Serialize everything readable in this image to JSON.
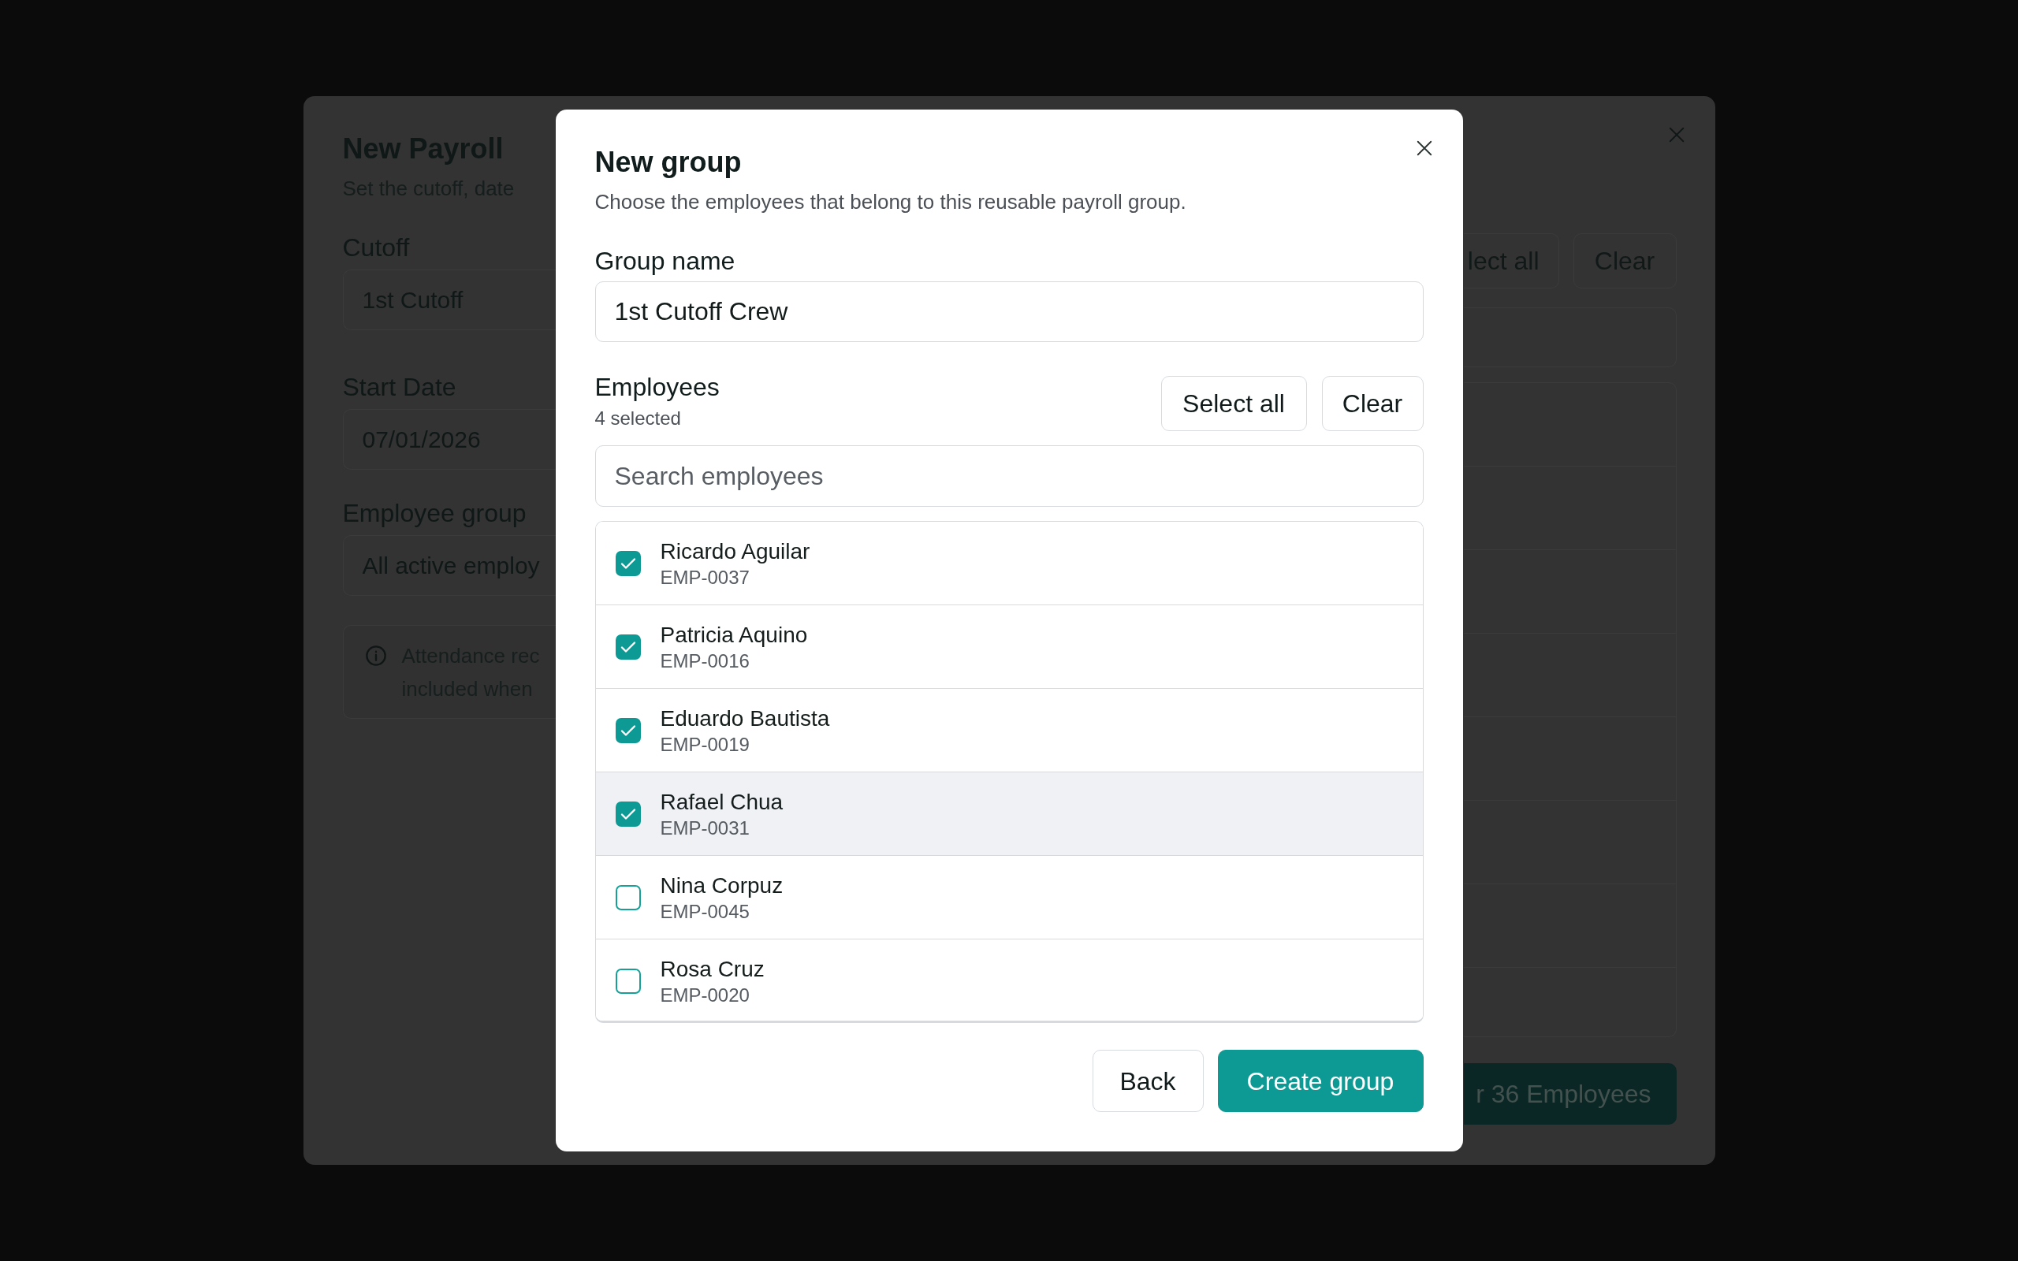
{
  "payroll_dialog": {
    "title": "New Payroll",
    "description": "Set the cutoff, date",
    "fields": [
      {
        "label": "Cutoff",
        "value": "1st Cutoff"
      },
      {
        "label": "Start Date",
        "value": "07/01/2026"
      },
      {
        "label": "Employee group",
        "value": "All active employ"
      }
    ],
    "notice": {
      "lines": [
        "Attendance rec",
        "included when"
      ]
    },
    "employee_buttons": [
      "lect all",
      "Clear"
    ],
    "submit_button": "r 36 Employees"
  },
  "group_dialog": {
    "title": "New group",
    "description": "Choose the employees that belong to this reusable payroll group.",
    "group_name": {
      "label": "Group name",
      "value": "1st Cutoff Crew"
    },
    "employees": {
      "label": "Employees",
      "count": "4 selected",
      "buttons": [
        "Select all",
        "Clear"
      ],
      "search": {
        "placeholder": "Search employees"
      },
      "rows": [
        {
          "name": "Ricardo Aguilar",
          "id": "EMP-0037",
          "checked": true,
          "hovered": false
        },
        {
          "name": "Patricia Aquino",
          "id": "EMP-0016",
          "checked": true,
          "hovered": false
        },
        {
          "name": "Eduardo Bautista",
          "id": "EMP-0019",
          "checked": true,
          "hovered": false
        },
        {
          "name": "Rafael Chua",
          "id": "EMP-0031",
          "checked": true,
          "hovered": true
        },
        {
          "name": "Nina Corpuz",
          "id": "EMP-0045",
          "checked": false,
          "hovered": false
        },
        {
          "name": "Rosa Cruz",
          "id": "EMP-0020",
          "checked": false,
          "hovered": false
        }
      ]
    },
    "footer_buttons": [
      {
        "label": "Back",
        "kind": "secondary"
      },
      {
        "label": "Create group",
        "kind": "primary"
      }
    ]
  }
}
